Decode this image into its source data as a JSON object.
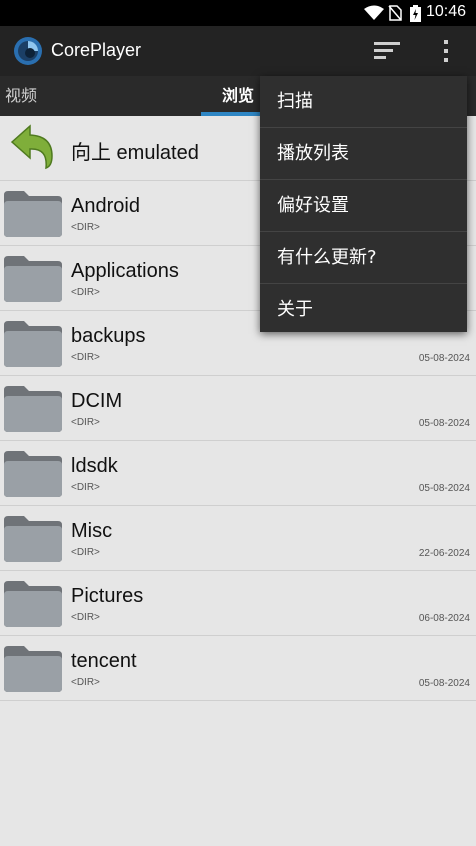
{
  "status_bar": {
    "time": "10:46"
  },
  "app": {
    "title": "CorePlayer"
  },
  "tabs": [
    {
      "label": "视频"
    },
    {
      "label": "浏览"
    }
  ],
  "list": {
    "up_label": "向上 emulated",
    "items": [
      {
        "name": "Android",
        "type": "<DIR>",
        "date": ""
      },
      {
        "name": "Applications",
        "type": "<DIR>",
        "date": ""
      },
      {
        "name": "backups",
        "type": "<DIR>",
        "date": "05-08-2024"
      },
      {
        "name": "DCIM",
        "type": "<DIR>",
        "date": "05-08-2024"
      },
      {
        "name": "ldsdk",
        "type": "<DIR>",
        "date": "05-08-2024"
      },
      {
        "name": "Misc",
        "type": "<DIR>",
        "date": "22-06-2024"
      },
      {
        "name": "Pictures",
        "type": "<DIR>",
        "date": "06-08-2024"
      },
      {
        "name": "tencent",
        "type": "<DIR>",
        "date": "05-08-2024"
      }
    ]
  },
  "menu": {
    "items": [
      {
        "label": "扫描"
      },
      {
        "label": "播放列表"
      },
      {
        "label": "偏好设置"
      },
      {
        "label": "有什么更新?"
      },
      {
        "label": "关于"
      }
    ]
  },
  "colors": {
    "accent": "#2e86c4",
    "action_bar": "#232323",
    "menu_bg": "#2f2f2f",
    "list_bg": "#e6e6e6"
  }
}
